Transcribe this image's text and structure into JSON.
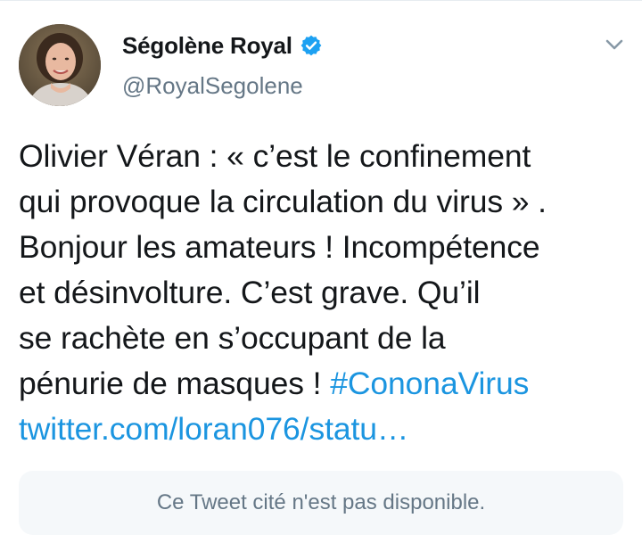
{
  "author": {
    "display_name": "Ségolène Royal",
    "handle": "@RoyalSegolene",
    "verified": true,
    "avatar_icon": "profile-photo"
  },
  "tweet": {
    "lines": [
      "Olivier Véran : « c’est le confinement",
      "qui provoque la circulation du virus » .",
      "Bonjour les amateurs ! Incompétence",
      "et désinvolture. C’est grave. Qu’il",
      "se rachète en s’occupant de la",
      "pénurie de masques ! "
    ],
    "hashtag": "#CononaVirus",
    "url_text": "twitter.com/loran076/statu…"
  },
  "quoted_tweet": {
    "unavailable_text": "Ce Tweet cité n'est pas disponible."
  },
  "colors": {
    "link": "#1b95e0",
    "verified_badge": "#1da1f2",
    "secondary_text": "#657786",
    "card_background": "#f5f8fa"
  },
  "icons": {
    "verified": "verified-badge-icon",
    "menu": "chevron-down-icon"
  }
}
